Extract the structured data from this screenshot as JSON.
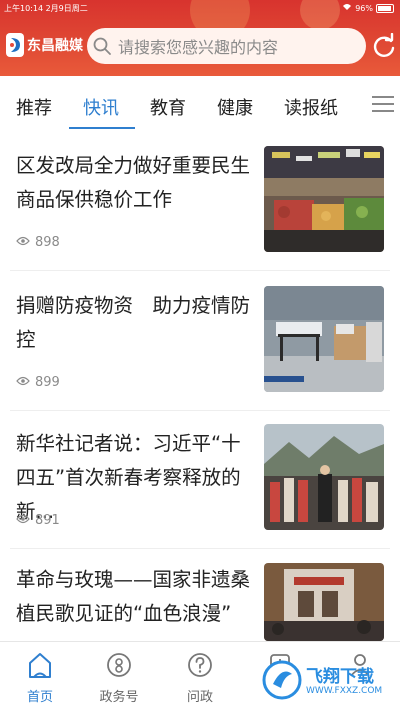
{
  "status_bar": {
    "time": "上午10:14  2月9日周二",
    "battery": "96%",
    "battery_level": 0.96
  },
  "header": {
    "app_name": "东昌融媒",
    "search_placeholder": "请搜索您感兴趣的内容"
  },
  "tabs": [
    {
      "label": "推荐",
      "active": false
    },
    {
      "label": "快讯",
      "active": true
    },
    {
      "label": "教育",
      "active": false
    },
    {
      "label": "健康",
      "active": false
    },
    {
      "label": "读报纸",
      "active": false
    }
  ],
  "articles": [
    {
      "title": "区发改局全力做好重要民生商品保供稳价工作",
      "views": "898"
    },
    {
      "title": "捐赠防疫物资　助力疫情防控",
      "views": "899"
    },
    {
      "title": "新华社记者说：习近平“十四五”首次新春考察释放的新...",
      "views": "891"
    },
    {
      "title": "革命与玫瑰——国家非遗桑植民歌见证的“血色浪漫”",
      "views": ""
    }
  ],
  "bottom_nav": [
    {
      "label": "首页",
      "icon": "home-icon",
      "active": true
    },
    {
      "label": "政务号",
      "icon": "government-icon",
      "active": false
    },
    {
      "label": "问政",
      "icon": "question-icon",
      "active": false
    },
    {
      "label": "",
      "icon": "service-icon",
      "active": false
    },
    {
      "label": "",
      "icon": "profile-icon",
      "active": false
    }
  ],
  "watermark": {
    "text": "飞翔下载",
    "url": "WWW.FXXZ.COM"
  },
  "colors": {
    "header_red": "#d8332e",
    "accent_blue": "#2f7fcf"
  }
}
